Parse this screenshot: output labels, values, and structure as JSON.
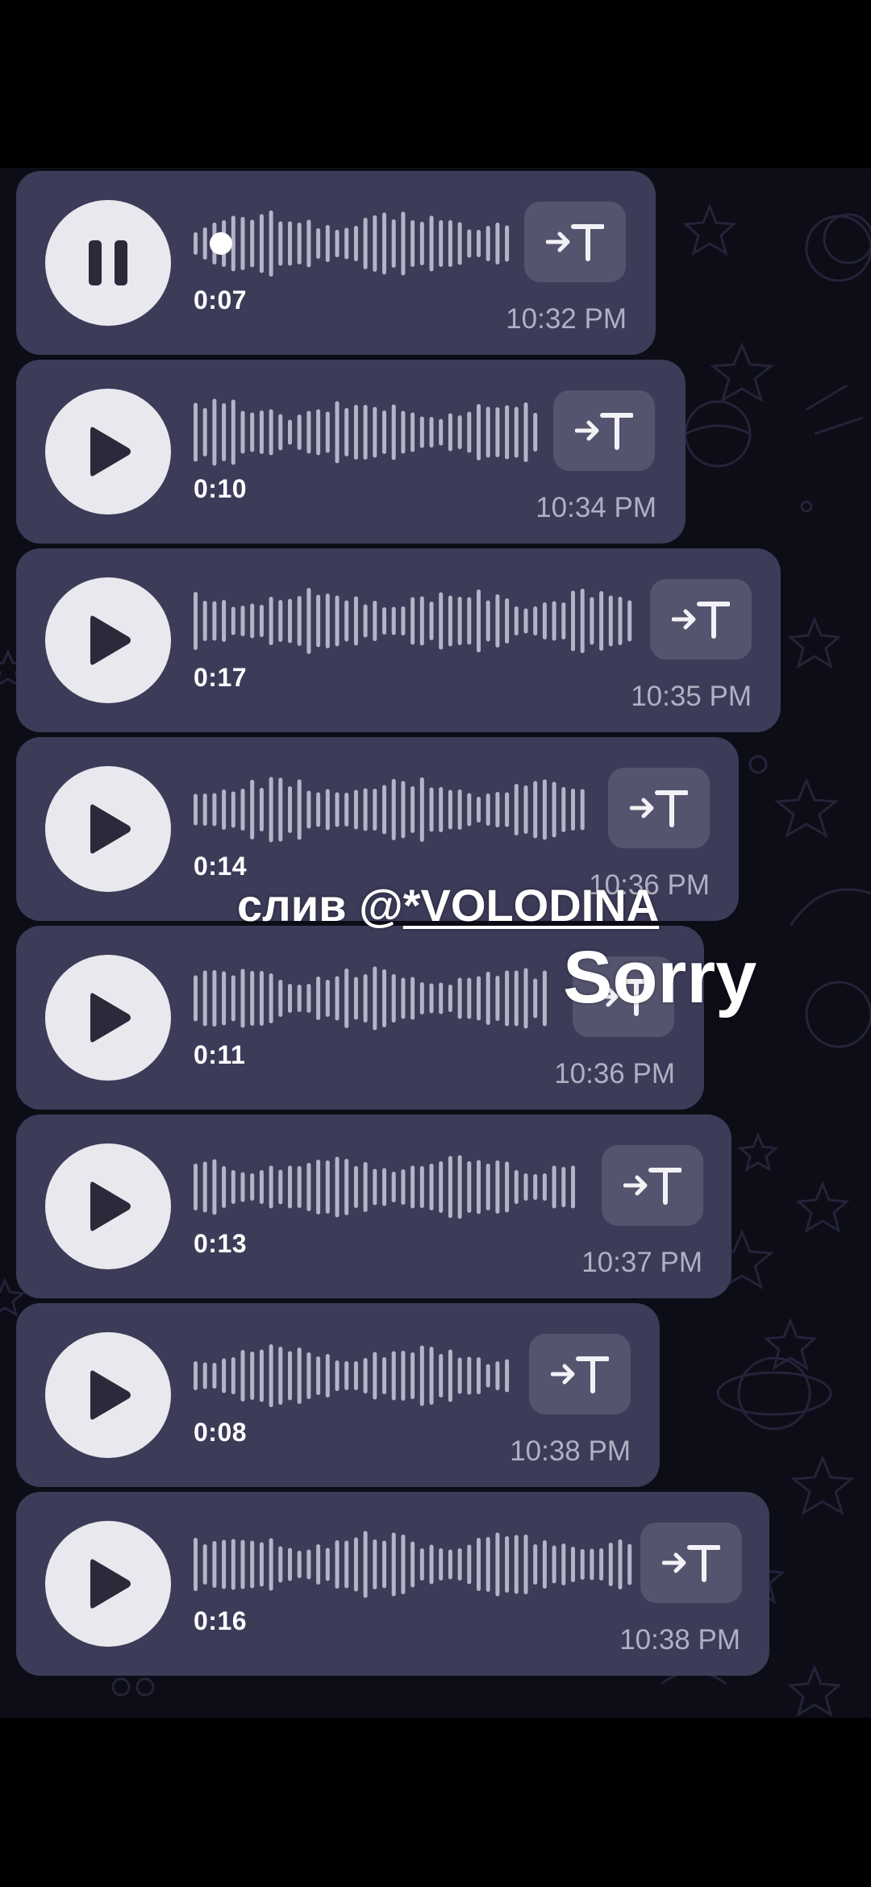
{
  "colors": {
    "bubble": "#3c3b58",
    "play_button": "#e8e8ee",
    "transcribe_button": "#55546e",
    "waveform": "#b4b4c6",
    "time_text": "#b0b0c2",
    "background": "#0d0d17"
  },
  "messages": [
    {
      "state": "playing",
      "icon": "pause-icon",
      "duration": "0:07",
      "time": "10:32 PM",
      "progress": 0.05
    },
    {
      "state": "paused",
      "icon": "play-icon",
      "duration": "0:10",
      "time": "10:34 PM"
    },
    {
      "state": "paused",
      "icon": "play-icon",
      "duration": "0:17",
      "time": "10:35 PM"
    },
    {
      "state": "paused",
      "icon": "play-icon",
      "duration": "0:14",
      "time": "10:36 PM"
    },
    {
      "state": "paused",
      "icon": "play-icon",
      "duration": "0:11",
      "time": "10:36 PM"
    },
    {
      "state": "paused",
      "icon": "play-icon",
      "duration": "0:13",
      "time": "10:37 PM"
    },
    {
      "state": "paused",
      "icon": "play-icon",
      "duration": "0:08",
      "time": "10:38 PM"
    },
    {
      "state": "paused",
      "icon": "play-icon",
      "duration": "0:16",
      "time": "10:38 PM"
    }
  ],
  "transcribe_icon": "speech-to-text-icon",
  "overlay": {
    "handle_prefix": "слив @",
    "handle_name": "*VOLODINA",
    "sorry": "Sorry"
  }
}
